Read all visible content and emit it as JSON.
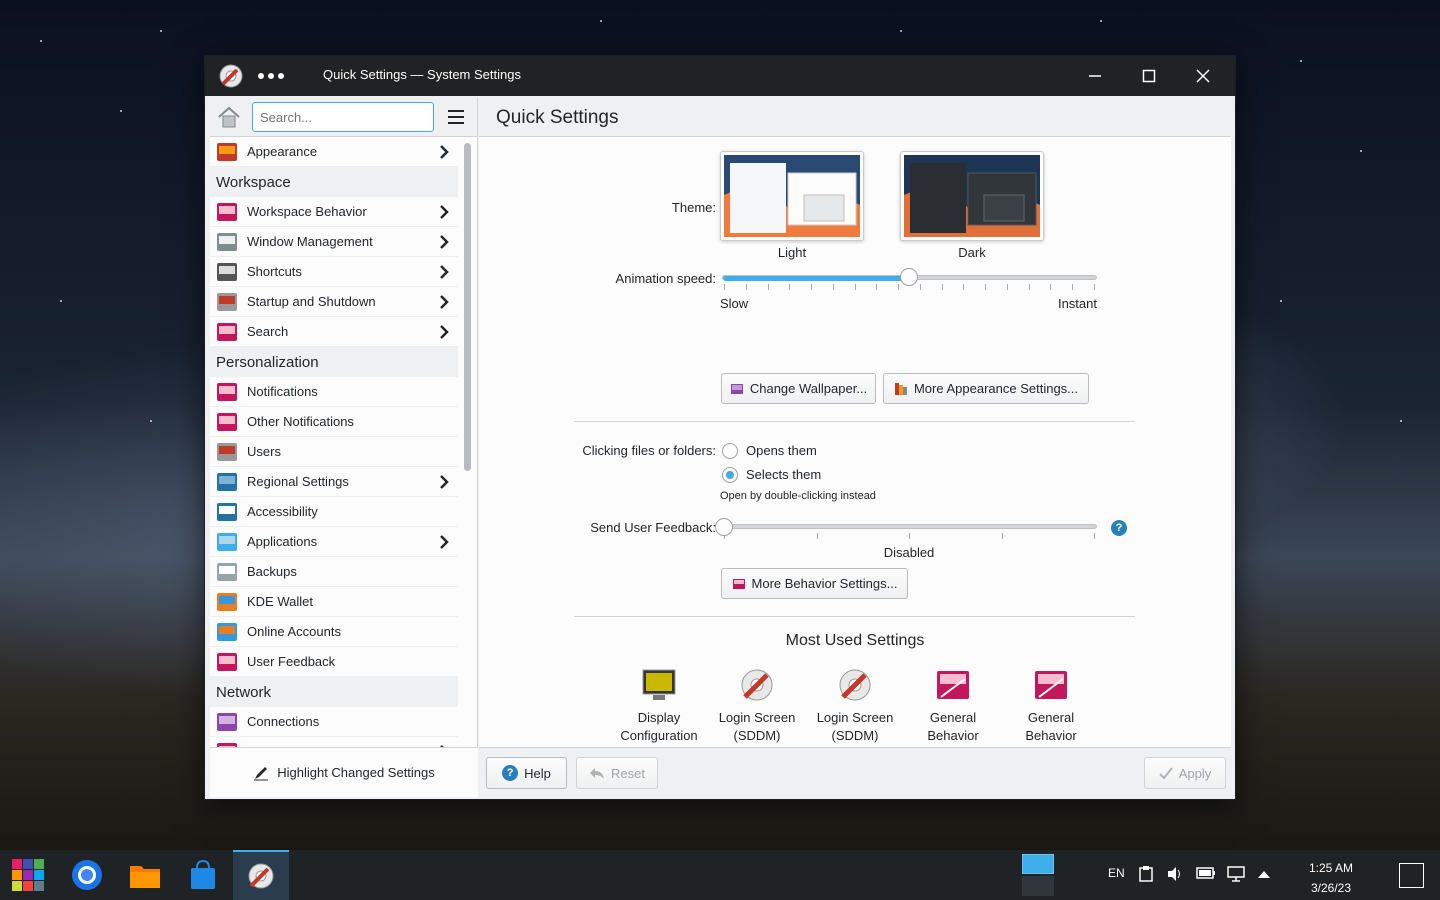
{
  "window": {
    "title": "Quick Settings — System Settings"
  },
  "sidebar": {
    "search_placeholder": "Search...",
    "items": [
      {
        "type": "item",
        "label": "Appearance",
        "icon": "appearance-icon",
        "arrow": true
      },
      {
        "type": "category",
        "label": "Workspace"
      },
      {
        "type": "item",
        "label": "Workspace Behavior",
        "icon": "workspace-behavior-icon",
        "arrow": true
      },
      {
        "type": "item",
        "label": "Window Management",
        "icon": "window-management-icon",
        "arrow": true
      },
      {
        "type": "item",
        "label": "Shortcuts",
        "icon": "keyboard-icon",
        "arrow": true
      },
      {
        "type": "item",
        "label": "Startup and Shutdown",
        "icon": "startup-shutdown-icon",
        "arrow": true
      },
      {
        "type": "item",
        "label": "Search",
        "icon": "search-settings-icon",
        "arrow": true
      },
      {
        "type": "category",
        "label": "Personalization"
      },
      {
        "type": "item",
        "label": "Notifications",
        "icon": "notifications-icon",
        "arrow": false
      },
      {
        "type": "item",
        "label": "Other Notifications",
        "icon": "other-notifications-icon",
        "arrow": false
      },
      {
        "type": "item",
        "label": "Users",
        "icon": "users-icon",
        "arrow": false
      },
      {
        "type": "item",
        "label": "Regional Settings",
        "icon": "regional-settings-icon",
        "arrow": true
      },
      {
        "type": "item",
        "label": "Accessibility",
        "icon": "accessibility-icon",
        "arrow": false
      },
      {
        "type": "item",
        "label": "Applications",
        "icon": "applications-icon",
        "arrow": true
      },
      {
        "type": "item",
        "label": "Backups",
        "icon": "backups-icon",
        "arrow": false
      },
      {
        "type": "item",
        "label": "KDE Wallet",
        "icon": "kde-wallet-icon",
        "arrow": false
      },
      {
        "type": "item",
        "label": "Online Accounts",
        "icon": "online-accounts-icon",
        "arrow": false
      },
      {
        "type": "item",
        "label": "User Feedback",
        "icon": "user-feedback-icon",
        "arrow": false
      },
      {
        "type": "category",
        "label": "Network"
      },
      {
        "type": "item",
        "label": "Connections",
        "icon": "connections-icon",
        "arrow": false
      },
      {
        "type": "item",
        "label": "",
        "icon": "settings-icon",
        "arrow": true
      }
    ],
    "highlight_label": "Highlight Changed Settings"
  },
  "main": {
    "title": "Quick Settings",
    "theme_label": "Theme:",
    "theme_light": "Light",
    "theme_dark": "Dark",
    "animation_label": "Animation speed:",
    "animation_slow": "Slow",
    "animation_instant": "Instant",
    "animation_value": 0.5,
    "change_wallpaper": "Change Wallpaper...",
    "more_appearance": "More Appearance Settings...",
    "clicking_label": "Clicking files or folders:",
    "opens_them": "Opens them",
    "selects_them": "Selects them",
    "selects_hint": "Open by double-clicking instead",
    "feedback_label": "Send User Feedback:",
    "feedback_value_text": "Disabled",
    "feedback_value": 0,
    "more_behavior": "More Behavior Settings...",
    "most_used_title": "Most Used Settings",
    "most_used": [
      {
        "line1": "Display",
        "line2": "Configuration"
      },
      {
        "line1": "Login Screen",
        "line2": "(SDDM)"
      },
      {
        "line1": "Login Screen",
        "line2": "(SDDM)"
      },
      {
        "line1": "General",
        "line2": "Behavior"
      },
      {
        "line1": "General",
        "line2": "Behavior"
      }
    ]
  },
  "footer": {
    "help": "Help",
    "reset": "Reset",
    "apply": "Apply"
  },
  "taskbar": {
    "language": "EN",
    "time": "1:25 AM",
    "date": "3/26/23"
  },
  "colors": {
    "accent": "#3daee9",
    "titlebar": "#202326",
    "panel": "#fcfcfc"
  }
}
